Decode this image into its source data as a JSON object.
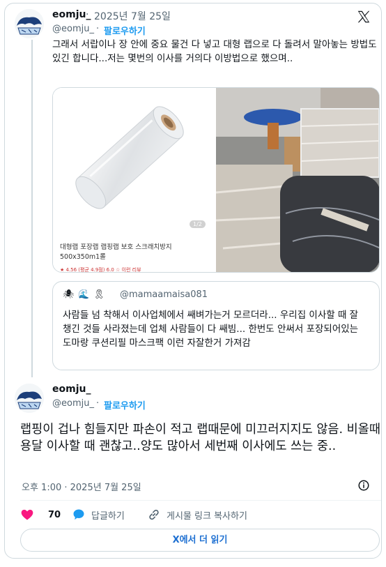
{
  "tweet1": {
    "name": "eomju_",
    "dot": "·",
    "date": "2025년 7월 25일",
    "handle": "@eomju_",
    "handle_dot": "·",
    "follow_label": "팔로우하기",
    "text": "그래서 서랍이나 장 안에 중요 물건 다 넣고 대형 랩으로 다 돌려서 말아놓는 방법도 있긴 합니다...저는 몇번의 이사를 거의다 이방법으로 했으며..",
    "media": {
      "product_title": "대형랩 포장랩 랩핑랩 보호 스크래치방지 500x350m1롤",
      "product_rating": "★ 4.56 (평균 4.9점) 6.0 ☆ 이런 리뷰",
      "page_indicator": "1/2"
    },
    "quote": {
      "emojis": [
        "🕷",
        "🌊",
        "🎗"
      ],
      "handle": "@mamaamaisa081",
      "text": "사람들 넘 착해서 이사업체에서 쌔벼가는거 모르더라... 우리집 이사할 때 잘 챙긴 것들 사라졌는데 업체 사람들이 다 쌔빔... 한번도 안써서 포장되어있는 도마랑 쿠션리필 마스크팩 이런 자잘한거 가져감"
    }
  },
  "tweet2": {
    "name": "eomju_",
    "handle": "@eomju_",
    "handle_dot": "·",
    "follow_label": "팔로우하기",
    "text": "랩핑이 겁나 힘들지만 파손이 적고 랩때문에 미끄러지지도 않음. 비올때 용달 이사할 때 괜찮고..양도 많아서 세번째 이사에도 쓰는 중..",
    "timestamp": "오후 1:00 · 2025년 7월 25일"
  },
  "actions": {
    "like_count": "70",
    "reply_label": "답글하기",
    "copy_link_label": "게시물 링크 복사하기"
  },
  "read_more_label": "X에서 더 읽기",
  "icons": {
    "x_logo": "x-logo-icon",
    "heart": "heart-icon",
    "reply": "speech-bubble-icon",
    "link": "link-icon",
    "info": "info-icon"
  },
  "colors": {
    "link_blue": "#1d9bf0",
    "heart_pink": "#f91880",
    "text_gray": "#536471",
    "border": "#cfd9de"
  }
}
